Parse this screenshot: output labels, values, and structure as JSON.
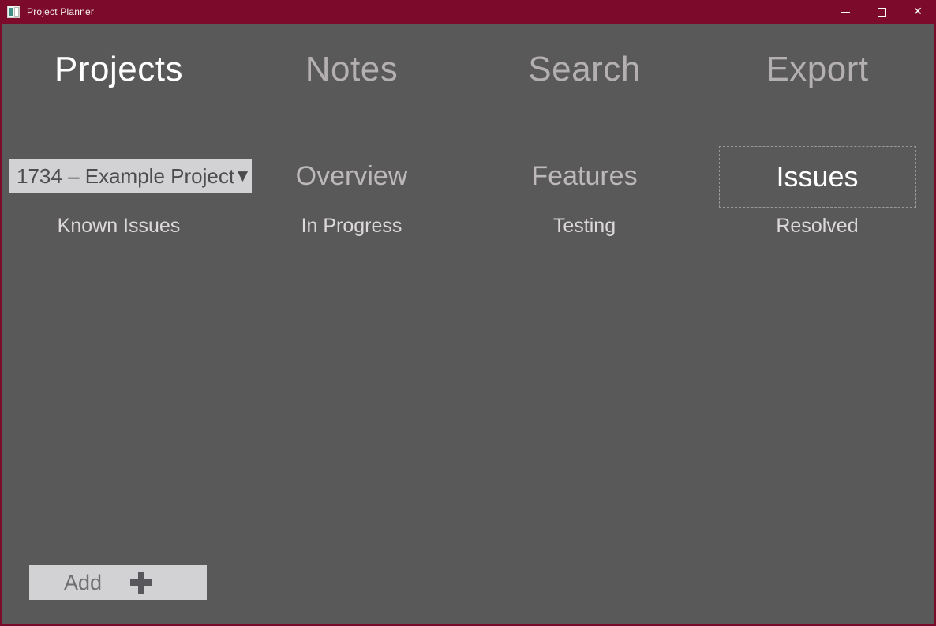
{
  "window": {
    "title": "Project Planner",
    "icon": "app-window-icon",
    "titlebar_color": "#7b0a2b",
    "client_color": "#595959",
    "controls": [
      {
        "name": "minimize",
        "glyph": "minimize"
      },
      {
        "name": "maximize",
        "glyph": "maximize"
      },
      {
        "name": "close",
        "glyph": "✕"
      }
    ]
  },
  "header_tabs": [
    {
      "label": "Projects",
      "active": true
    },
    {
      "label": "Notes",
      "active": false
    },
    {
      "label": "Search",
      "active": false
    },
    {
      "label": "Export",
      "active": false
    }
  ],
  "controls_row": {
    "project_select": {
      "value": "1734 – Example Project",
      "arrow": "▼",
      "background": "#d2d2d4",
      "text_color": "#4d4d4d"
    },
    "section_titles": [
      "Overview",
      "Features"
    ],
    "issues_button": {
      "label": "Issues",
      "focused": true,
      "border_color": "#9b9799"
    }
  },
  "sublabels": [
    "Known Issues",
    "In Progress",
    "Testing",
    "Resolved"
  ],
  "add_button": {
    "label": "Add",
    "icon": "plus-icon",
    "background": "#d2d2d4",
    "text_color": "#6f6f73"
  }
}
